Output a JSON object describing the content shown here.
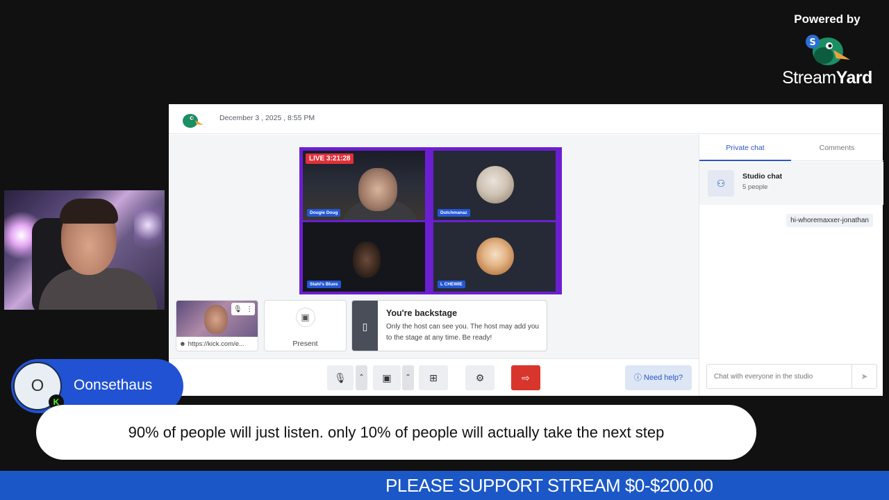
{
  "powered": {
    "label": "Powered by",
    "brand_light": "Stream",
    "brand_bold": "Yard"
  },
  "studio": {
    "datetime": "December 3 , 2025 , 8:55 PM",
    "stage": {
      "live_badge": "LIVE 3:21:28",
      "tiles": [
        {
          "name": "Dougie Doug"
        },
        {
          "name": "Dutchmanaz"
        },
        {
          "name": "Stahl's Blues"
        },
        {
          "name": "L CHEWIE"
        }
      ]
    },
    "self_preview": {
      "url": "https://kick.com/e..."
    },
    "present": {
      "label": "Present"
    },
    "backstage": {
      "title": "You're backstage",
      "description": "Only the host can see you. The host may add you to the stage at any time. Be ready!"
    },
    "controls": {
      "need_help": "Need help?"
    },
    "chat": {
      "tabs": [
        {
          "label": "Private chat",
          "active": true
        },
        {
          "label": "Comments",
          "active": false
        }
      ],
      "studio_chat_title": "Studio chat",
      "studio_chat_count": "5 people",
      "messages": [
        "hi-whoremaxxer-jonathan"
      ],
      "input_placeholder": "Chat with everyone in the studio"
    }
  },
  "user_badge": {
    "initial": "O",
    "name": "Oonsethaus",
    "platform_icon": "K"
  },
  "caption": "90% of people will just listen. only 10% of people will actually take the next step",
  "ticker": "PLEASE SUPPORT STREAM $0-$200.00",
  "colors": {
    "accent": "#2a56c6",
    "stage_border": "#6b1fd1",
    "ticker_bg": "#1b57c7",
    "live": "#e0313a",
    "exit": "#d8362d"
  }
}
